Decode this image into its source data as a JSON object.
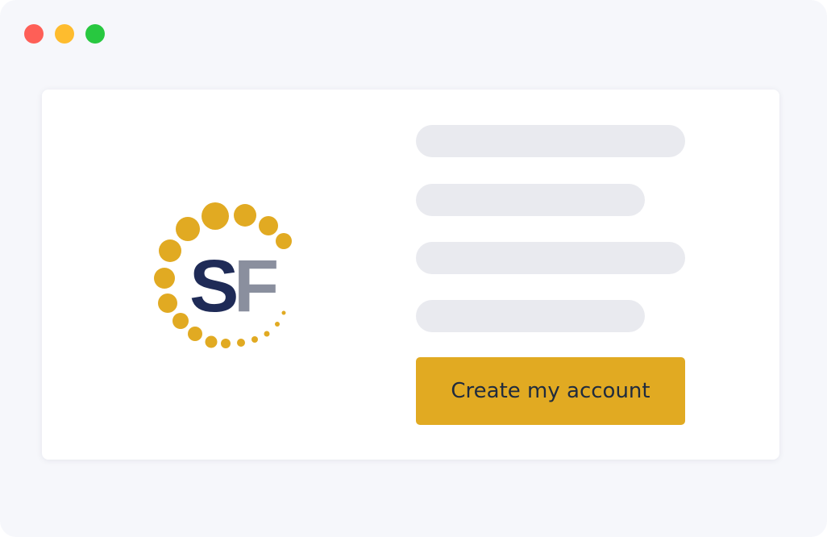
{
  "window": {
    "background": "#f6f7fb",
    "controls": [
      {
        "name": "close",
        "color": "#fe5f57"
      },
      {
        "name": "minimize",
        "color": "#febc2e"
      },
      {
        "name": "zoom",
        "color": "#28c840"
      }
    ]
  },
  "logo": {
    "icon": "sf-logo-icon",
    "letter_s": "S",
    "letter_f": "F",
    "colors": {
      "dots": "#e1aa22",
      "s": "#1f2b57",
      "f": "#8a8f9e"
    }
  },
  "form": {
    "fields": [
      {
        "name": "field-1",
        "value": "",
        "placeholder": ""
      },
      {
        "name": "field-2",
        "value": "",
        "placeholder": ""
      },
      {
        "name": "field-3",
        "value": "",
        "placeholder": ""
      },
      {
        "name": "field-4",
        "value": "",
        "placeholder": ""
      }
    ],
    "submit_label": "Create my account",
    "submit_color": "#e1aa22",
    "submit_text_color": "#1f2b3e"
  }
}
